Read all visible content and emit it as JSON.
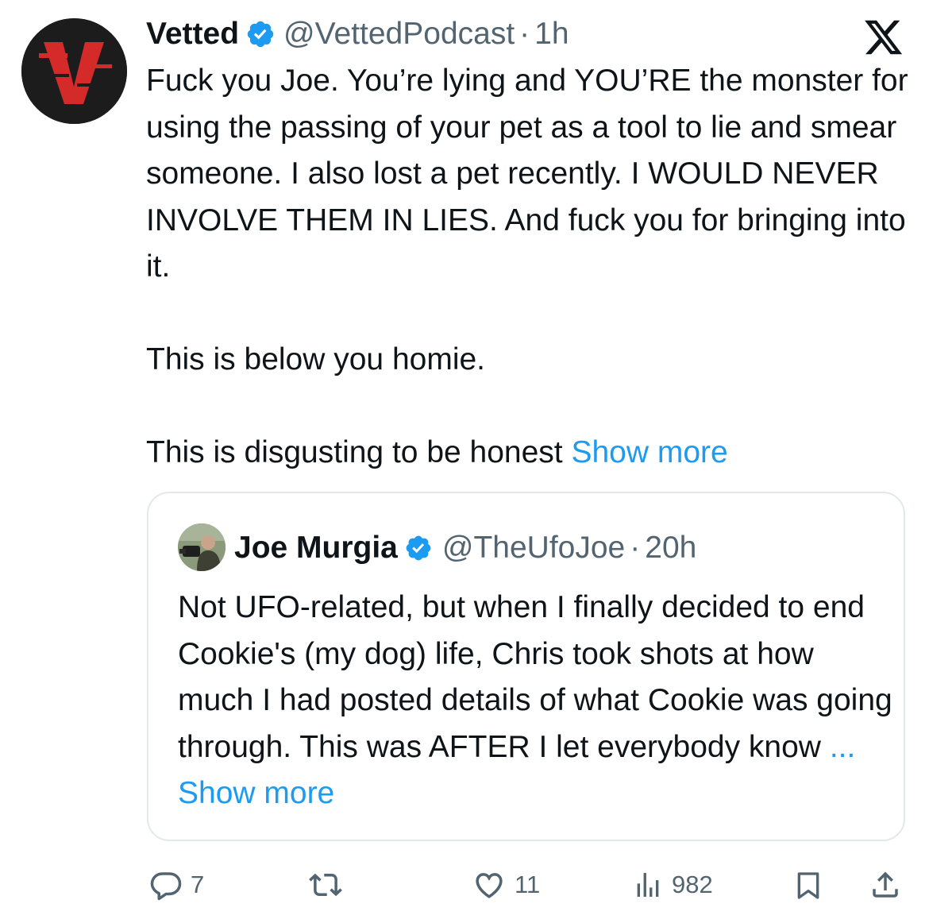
{
  "tweet": {
    "author_name": "Vetted",
    "handle": "@VettedPodcast",
    "separator": "·",
    "time": "1h",
    "body_paragraphs": [
      "Fuck you Joe. You’re lying and YOU’RE the monster for using the passing of your pet as a tool to lie and smear someone. I also lost a pet recently. I WOULD NEVER INVOLVE THEM IN LIES. And fuck you for bringing into it.",
      "This is below you homie.",
      "This is disgusting to be honest"
    ],
    "show_more": "Show more",
    "avatar_icon": "vetted-logo-icon",
    "verified_icon": "verified-badge-icon",
    "close_icon": "x-logo-icon"
  },
  "quoted": {
    "author_name": "Joe Murgia",
    "handle": "@TheUfoJoe",
    "separator": "·",
    "time": "20h",
    "body": "Not UFO-related, but when I finally decided to end Cookie's (my dog) life, Chris took shots at how much I had posted details of what Cookie was going through. This was AFTER I let everybody know",
    "ellipsis": "...",
    "show_more": "Show more"
  },
  "actions": {
    "replies": "7",
    "reposts": "",
    "likes": "11",
    "views": "982",
    "icons": [
      "reply-icon",
      "repost-icon",
      "like-icon",
      "views-icon",
      "bookmark-icon",
      "share-icon"
    ]
  },
  "colors": {
    "text": "#0f1419",
    "secondary": "#536471",
    "link": "#1d9bf0",
    "border": "#e3e8eb",
    "vetted_red": "#d42a2a"
  }
}
